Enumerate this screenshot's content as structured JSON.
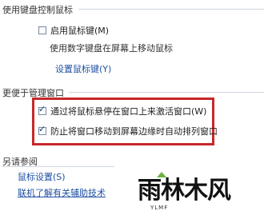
{
  "keyboard_section": {
    "title": "使用键盘控制鼠标",
    "mouse_keys_checkbox": {
      "label": "启用鼠标键(M)",
      "checked": false
    },
    "mouse_keys_desc": "使用数字键盘在屏幕上移动鼠标",
    "setup_link": "设置鼠标键(Y)"
  },
  "window_section": {
    "title": "更便于管理窗口",
    "hover_activate": {
      "label": "通过将鼠标悬停在窗口上来激活窗口(W)",
      "checked": true
    },
    "prevent_arrange": {
      "label": "防止将窗口移动到屏幕边缘时自动排列窗口",
      "checked": true
    },
    "highlight_color": "#c7282a"
  },
  "see_also": {
    "title": "另请参阅",
    "links": [
      "鼠标设置(S)",
      "联机了解有关辅助技术"
    ]
  },
  "watermark": {
    "logo_text": "雨林木风",
    "sub_text": "YLMF"
  }
}
